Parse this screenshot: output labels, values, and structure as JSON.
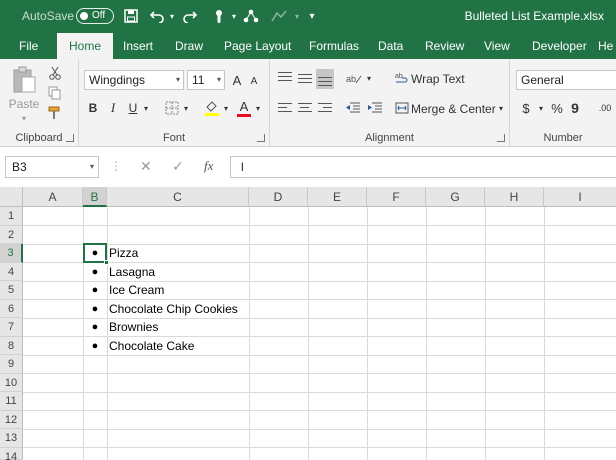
{
  "title_bar": {
    "autosave_label": "AutoSave",
    "autosave_state": "Off",
    "document_title": "Bulleted List Example.xlsx"
  },
  "tabs": [
    {
      "label": "File",
      "active": false
    },
    {
      "label": "Home",
      "active": true
    },
    {
      "label": "Insert",
      "active": false
    },
    {
      "label": "Draw",
      "active": false
    },
    {
      "label": "Page Layout",
      "active": false
    },
    {
      "label": "Formulas",
      "active": false
    },
    {
      "label": "Data",
      "active": false
    },
    {
      "label": "Review",
      "active": false
    },
    {
      "label": "View",
      "active": false
    },
    {
      "label": "Developer",
      "active": false
    },
    {
      "label": "He",
      "active": false
    }
  ],
  "ribbon": {
    "clipboard": {
      "paste_label": "Paste",
      "group_label": "Clipboard"
    },
    "font": {
      "font_name": "Wingdings",
      "font_size": "11",
      "bold": "B",
      "italic": "I",
      "underline": "U",
      "group_label": "Font",
      "grow": "A",
      "shrink": "A",
      "font_color": "A"
    },
    "alignment": {
      "wrap_text": "Wrap Text",
      "merge_center": "Merge & Center",
      "group_label": "Alignment"
    },
    "number": {
      "format": "General",
      "currency": "$",
      "percent": "%",
      "comma": "9",
      "decimals": ".00",
      "group_label": "Number"
    }
  },
  "formula_bar": {
    "name_box": "B3",
    "fx_label": "fx",
    "content": "l"
  },
  "sheet": {
    "columns": [
      "A",
      "B",
      "C",
      "D",
      "E",
      "F",
      "G",
      "H",
      "I"
    ],
    "selected_column": "B",
    "rows": [
      "1",
      "2",
      "3",
      "4",
      "5",
      "6",
      "7",
      "8",
      "9",
      "10",
      "11",
      "12",
      "13",
      "14"
    ],
    "selected_row": "3",
    "selected_cell": "B3",
    "bullet_glyph": "●",
    "list_items": [
      "Pizza",
      "Lasagna",
      "Ice Cream",
      "Chocolate Chip Cookies",
      "Brownies",
      "Chocolate Cake"
    ]
  },
  "colors": {
    "brand": "#217346",
    "ribbon_bg": "#f3f3f3",
    "grid_line": "#dadada"
  }
}
